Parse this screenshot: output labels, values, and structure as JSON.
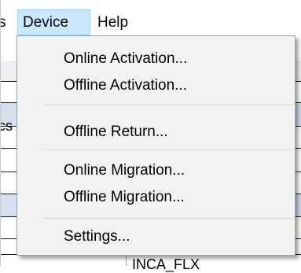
{
  "menubar": {
    "partial_left": "s",
    "items": [
      {
        "label": "Device"
      },
      {
        "label": "Help"
      }
    ]
  },
  "dropdown": {
    "items": [
      {
        "label": "Online Activation..."
      },
      {
        "label": "Offline Activation..."
      },
      {
        "label": "Offline Return..."
      },
      {
        "label": "Online Migration..."
      },
      {
        "label": "Offline Migration..."
      },
      {
        "label": "Settings..."
      }
    ]
  },
  "background": {
    "partial_text": "cs",
    "bottom_text": "INCA_FLX"
  },
  "colors": {
    "menubar_highlight": "#cce8ff",
    "menubar_highlight_border": "#99d1ff",
    "dropdown_bg": "#f2f2f2",
    "row_blue": "#d5deed"
  }
}
